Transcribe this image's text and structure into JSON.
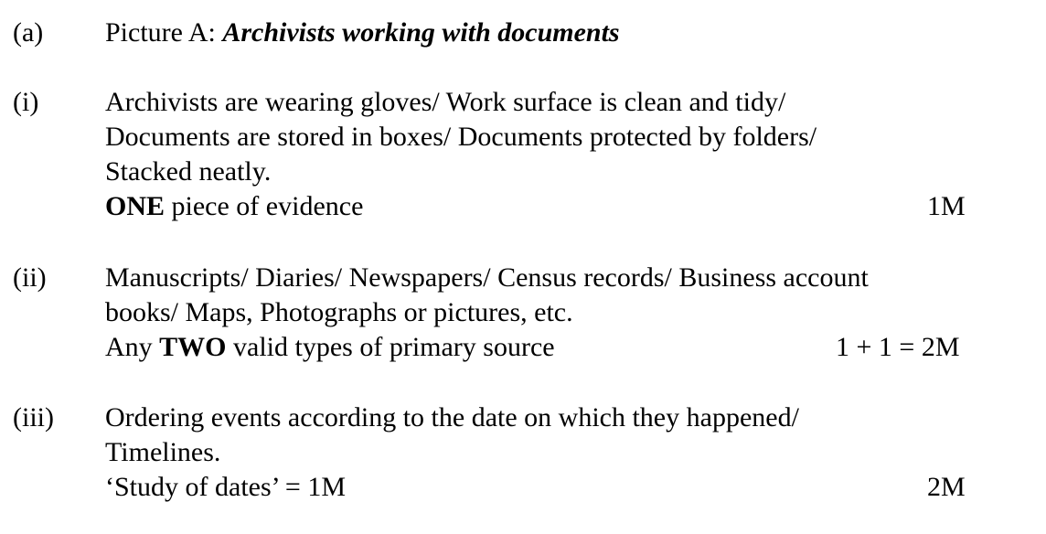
{
  "section_a": {
    "label": "(a)",
    "prefix": "Picture A: ",
    "title": "Archivists working with documents"
  },
  "part_i": {
    "label": "(i)",
    "lines": [
      "Archivists are wearing gloves/ Work surface is clean and tidy/",
      "Documents are stored in boxes/ Documents protected by folders/",
      "Stacked neatly."
    ],
    "criteria_bold": "ONE",
    "criteria_rest": " piece of evidence",
    "marks": "1M"
  },
  "part_ii": {
    "label": "(ii)",
    "lines": [
      "Manuscripts/ Diaries/ Newspapers/ Census records/ Business account",
      "books/ Maps, Photographs or pictures, etc."
    ],
    "criteria_pre": "Any ",
    "criteria_bold": "TWO",
    "criteria_rest": " valid types of primary source",
    "marks": "1 + 1 = 2M"
  },
  "part_iii": {
    "label": "(iii)",
    "lines": [
      "Ordering events according to the date on which they happened/",
      "Timelines."
    ],
    "criteria": "‘Study of dates’ = 1M",
    "marks": "2M"
  }
}
